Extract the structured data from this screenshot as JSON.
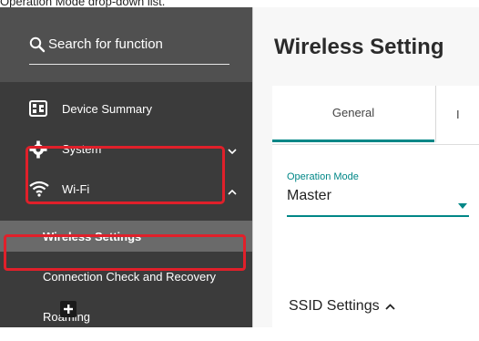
{
  "caption": "Operation Mode drop-down list.",
  "search": {
    "label": "Search for function"
  },
  "sidebar": {
    "items": [
      {
        "label": "Device Summary"
      },
      {
        "label": "System"
      },
      {
        "label": "Wi-Fi"
      }
    ],
    "wifi_subitems": [
      {
        "label": "Wireless Settings",
        "active": true
      },
      {
        "label": "Connection Check and Recovery"
      },
      {
        "label": "Roaming"
      }
    ]
  },
  "main": {
    "title": "Wireless Setting",
    "tabs": [
      {
        "label": "General"
      },
      {
        "label": "I"
      }
    ],
    "operation_mode": {
      "label": "Operation Mode",
      "value": "Master"
    },
    "ssid_settings": {
      "label": "SSID Settings"
    }
  },
  "colors": {
    "accent": "#008787",
    "highlight": "#e0202a",
    "sidebar": "#3b3b3b"
  }
}
